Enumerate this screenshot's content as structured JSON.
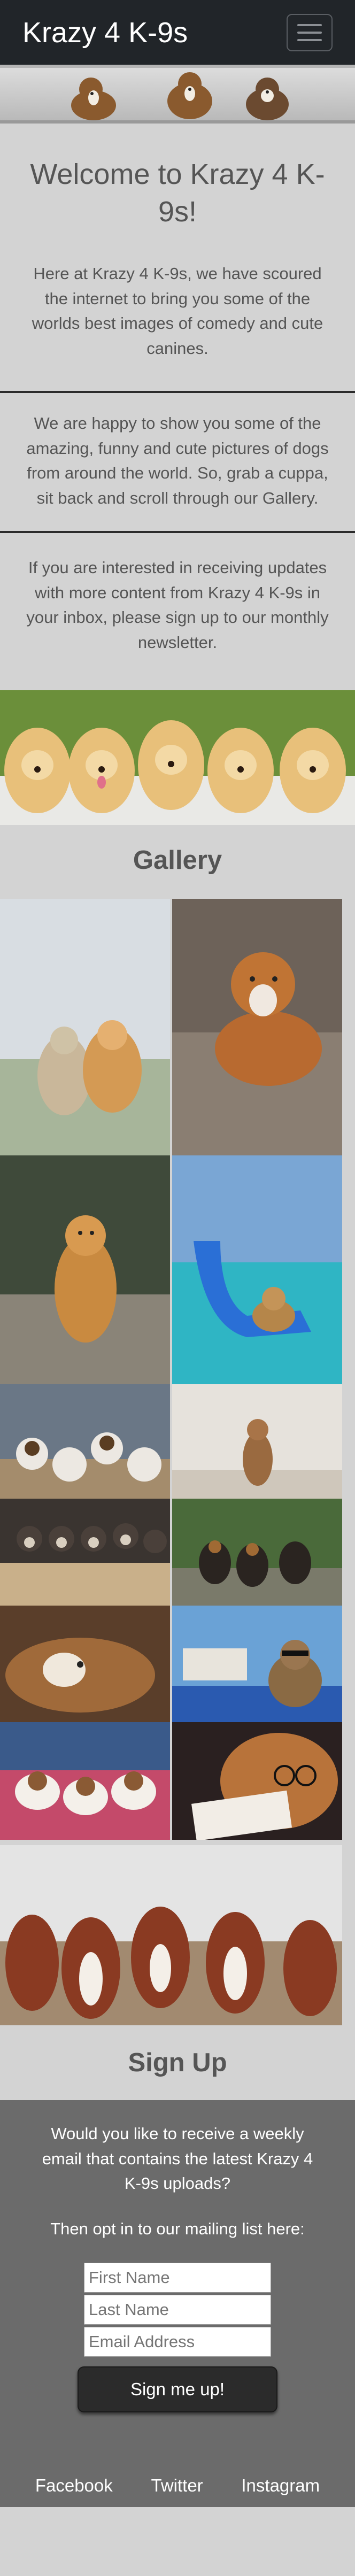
{
  "navbar": {
    "brand": "Krazy 4 K-9s",
    "menu_icon": "hamburger-menu-icon"
  },
  "intro": {
    "heading": "Welcome to Krazy 4 K-9s!",
    "paragraph1": "Here at Krazy 4 K-9s, we have scoured the internet to bring you some of the worlds best images of comedy and cute canines.",
    "paragraph2": "We are happy to show you some of the amazing, funny and cute pictures of dogs from around the world. So, grab a cuppa, sit back and scroll through our Gallery.",
    "paragraph3": "If you are interested in receiving updates with more content from Krazy 4 K-9s in your inbox, please sign up to our monthly newsletter."
  },
  "gallery": {
    "title": "Gallery"
  },
  "signup": {
    "title": "Sign Up",
    "question": "Would you like to receive a weekly email that contains the latest Krazy 4 K-9s uploads?",
    "optin": "Then opt in to our mailing list here:",
    "first_name_placeholder": "First Name",
    "last_name_placeholder": "Last Name",
    "email_placeholder": "Email Address",
    "submit_label": "Sign me up!"
  },
  "footer": {
    "facebook": "Facebook",
    "twitter": "Twitter",
    "instagram": "Instagram"
  },
  "colors": {
    "navbar": "#212529",
    "page": "#d3d3d3",
    "signup_bg": "#6b6b6b",
    "button": "#2b2b2b"
  }
}
